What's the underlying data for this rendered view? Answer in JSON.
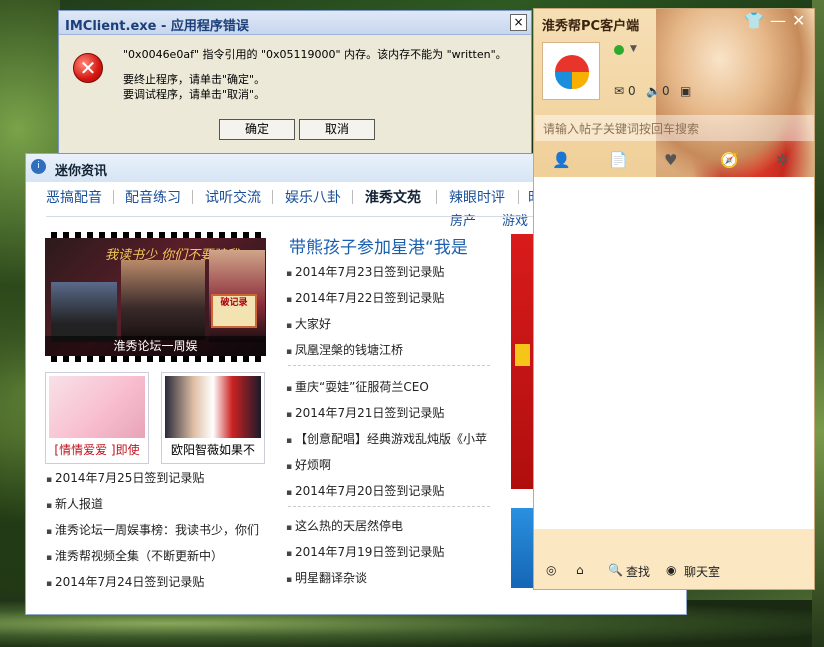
{
  "error_dialog": {
    "title": "IMClient.exe - 应用程序错误",
    "close": "×",
    "icon": "✕",
    "line1": "\"0x0046e0af\" 指令引用的 \"0x05119000\" 内存。该内存不能为 \"written\"。",
    "line2": "要终止程序，请单击\"确定\"。",
    "line3": "要调试程序，请单击\"取消\"。",
    "ok": "确定",
    "cancel": "取消"
  },
  "news": {
    "title": "迷你资讯",
    "tabs": [
      "恶搞配音",
      "配音练习",
      "试听交流",
      "娱乐八卦",
      "淮秀文苑",
      "辣眼时评",
      "时"
    ],
    "tabs_row2": [
      "房产",
      "游戏"
    ],
    "banner_script": "我读书少 你们不要骗我",
    "banner_badge": "破记录",
    "banner_caption": "淮秀论坛一周娱",
    "thumb1_caption": "[情情爱爱 ]即使",
    "thumb2_caption": "欧阳智薇如果不",
    "left_list": [
      "2014年7月25日签到记录贴",
      "新人报道",
      "淮秀论坛一周娱事榜：我读书少，你们",
      "淮秀帮视频全集（不断更新中）",
      "2014年7月24日签到记录贴"
    ],
    "headline": "带熊孩子参加星港“我是",
    "mid_list1": [
      "2014年7月23日签到记录贴",
      "2014年7月22日签到记录贴",
      "大家好",
      "凤凰涅槃的钱塘江桥"
    ],
    "mid_list2": [
      "重庆“耍娃”征服荷兰CEO",
      "2014年7月21日签到记录贴",
      "【创意配唱】经典游戏乱炖版《小苹",
      "好烦啊",
      "2014年7月20日签到记录贴"
    ],
    "mid_list3": [
      "这么热的天居然停电",
      "2014年7月19日签到记录贴",
      "明星翻译杂谈"
    ]
  },
  "client": {
    "title": "淮秀帮PC客户端",
    "skin_icon": "👕",
    "minimize": "—",
    "close": "✕",
    "mail_count": "0",
    "voice_count": "0",
    "search_placeholder": "请输入帖子关键词按回车搜索",
    "footer": {
      "find": "查找",
      "chat": "聊天室"
    }
  },
  "colors": {
    "accent": "#1a5fae",
    "error_red": "#d6150f",
    "client_bg": "#f6dfb5"
  }
}
